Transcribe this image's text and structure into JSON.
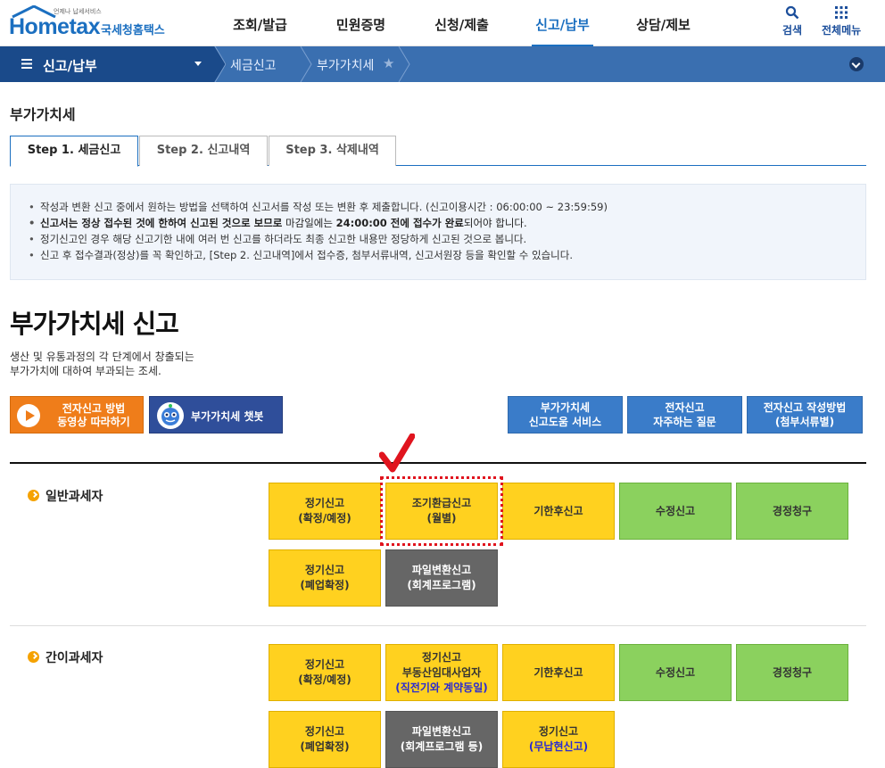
{
  "header": {
    "logo_main": "Hometax",
    "logo_small": "언제나 납세서비스",
    "logo_kr": "국세청홈택스",
    "nav": [
      "조회/발급",
      "민원증명",
      "신청/제출",
      "신고/납부",
      "상담/제보"
    ],
    "search_label": "검색",
    "allmenu_label": "전체메뉴"
  },
  "subnav": {
    "menu": "신고/납부",
    "crumb1": "세금신고",
    "crumb2": "부가가치세"
  },
  "page_title": "부가가치세",
  "tabs": [
    "Step 1. 세금신고",
    "Step 2. 신고내역",
    "Step 3. 삭제내역"
  ],
  "notice": {
    "line1": "작성과 변환 신고 중에서 원하는 방법을 선택하여 신고서를 작성 또는 변환 후 제출합니다. (신고이용시간 : 06:00:00 ~ 23:59:59)",
    "line2_bold": "신고서는 정상 접수된 것에 한하여 신고된 것으로 보므로",
    "line2_norm1": " 마감일에는 ",
    "line2_bold2": "24:00:00 전에 접수가 완료",
    "line2_norm2": "되어야 합니다.",
    "line3": "정기신고인 경우 해당 신고기한 내에 여러 번 신고를 하더라도 최종 신고한 내용만 정당하게 신고된 것으로 봅니다.",
    "line4": "신고 후 접수결과(정상)를 꼭 확인하고, [Step 2. 신고내역]에서 접수증, 첨부서류내역, 신고서원장 등을 확인할 수 있습니다."
  },
  "big_title": "부가가치세 신고",
  "desc": {
    "line1": "생산 및 유통과정의 각 단계에서 창출되는",
    "line2": "부가가치에 대하여 부과되는 조세."
  },
  "buttons": {
    "video_l1": "전자신고 방법",
    "video_l2": "동영상 따라하기",
    "chatbot": "부가가치세 챗봇",
    "help_l1": "부가가치세",
    "help_l2": "신고도움 서비스",
    "faq_l1": "전자신고",
    "faq_l2": "자주하는 질문",
    "guide_l1": "전자신고 작성방법",
    "guide_l2": "(첨부서류별)"
  },
  "general": {
    "label": "일반과세자",
    "b1_l1": "정기신고",
    "b1_l2": "(확정/예정)",
    "b2_l1": "조기환급신고",
    "b2_l2": "(월별)",
    "b3": "기한후신고",
    "b4": "수정신고",
    "b5": "경정청구",
    "b6_l1": "정기신고",
    "b6_l2": "(폐업확정)",
    "b7_l1": "파일변환신고",
    "b7_l2": "(회계프로그램)"
  },
  "simple": {
    "label": "간이과세자",
    "b1_l1": "정기신고",
    "b1_l2": "(확정/예정)",
    "b2_l1": "정기신고",
    "b2_l2": "부동산임대사업자",
    "b2_l3": "(직전기와 계약동일)",
    "b3": "기한후신고",
    "b4": "수정신고",
    "b5": "경정청구",
    "b6_l1": "정기신고",
    "b6_l2": "(폐업확정)",
    "b7_l1": "파일변환신고",
    "b7_l2": "(회계프로그램 등)",
    "b8_l1": "정기신고",
    "b8_l2": "(무납현신고)"
  },
  "colors": {
    "brand": "#1b6fc0",
    "subnav": "#3a6fb0",
    "yellow": "#ffd11f",
    "green": "#8bd15e",
    "gray": "#666666",
    "highlight": "#e0141e"
  }
}
